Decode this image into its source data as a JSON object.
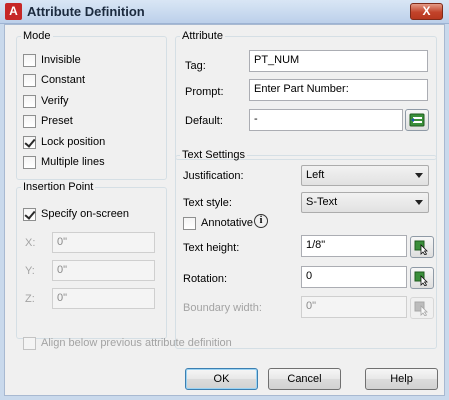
{
  "window": {
    "title": "Attribute Definition",
    "app_icon": "A",
    "close_glyph": "X"
  },
  "mode": {
    "legend": "Mode",
    "options": [
      {
        "label": "Invisible",
        "checked": false
      },
      {
        "label": "Constant",
        "checked": false
      },
      {
        "label": "Verify",
        "checked": false
      },
      {
        "label": "Preset",
        "checked": false
      },
      {
        "label": "Lock position",
        "checked": true
      },
      {
        "label": "Multiple lines",
        "checked": false
      }
    ]
  },
  "insertion_point": {
    "legend": "Insertion Point",
    "specify_on_screen": {
      "label": "Specify on-screen",
      "checked": true
    },
    "x": {
      "label": "X:",
      "value": "0\""
    },
    "y": {
      "label": "Y:",
      "value": "0\""
    },
    "z": {
      "label": "Z:",
      "value": "0\""
    }
  },
  "attribute": {
    "legend": "Attribute",
    "tag": {
      "label": "Tag:",
      "value": "PT_NUM"
    },
    "prompt": {
      "label": "Prompt:",
      "value": "Enter Part Number:"
    },
    "default": {
      "label": "Default:",
      "value": "-"
    }
  },
  "text_settings": {
    "legend": "Text Settings",
    "justification": {
      "label": "Justification:",
      "value": "Left"
    },
    "text_style": {
      "label": "Text style:",
      "value": "S-Text"
    },
    "annotative": {
      "label": "Annotative",
      "checked": false,
      "info_glyph": "i"
    },
    "text_height": {
      "label": "Text height:",
      "value": "1/8\""
    },
    "rotation": {
      "label": "Rotation:",
      "value": "0"
    },
    "boundary_width": {
      "label": "Boundary width:",
      "value": "0\""
    }
  },
  "align_below": {
    "label": "Align below previous attribute definition",
    "checked": false
  },
  "buttons": {
    "ok": "OK",
    "cancel": "Cancel",
    "help": "Help"
  },
  "colors": {
    "titlebar": "#c9d9ec",
    "client_bg": "#f0f0f0",
    "close_button": "#c2432a",
    "default_button_border": "#3c7fb1"
  },
  "icons": {
    "insert_field": "insert-field-icon",
    "pick_point": "pick-point-icon",
    "info": "info-icon"
  }
}
